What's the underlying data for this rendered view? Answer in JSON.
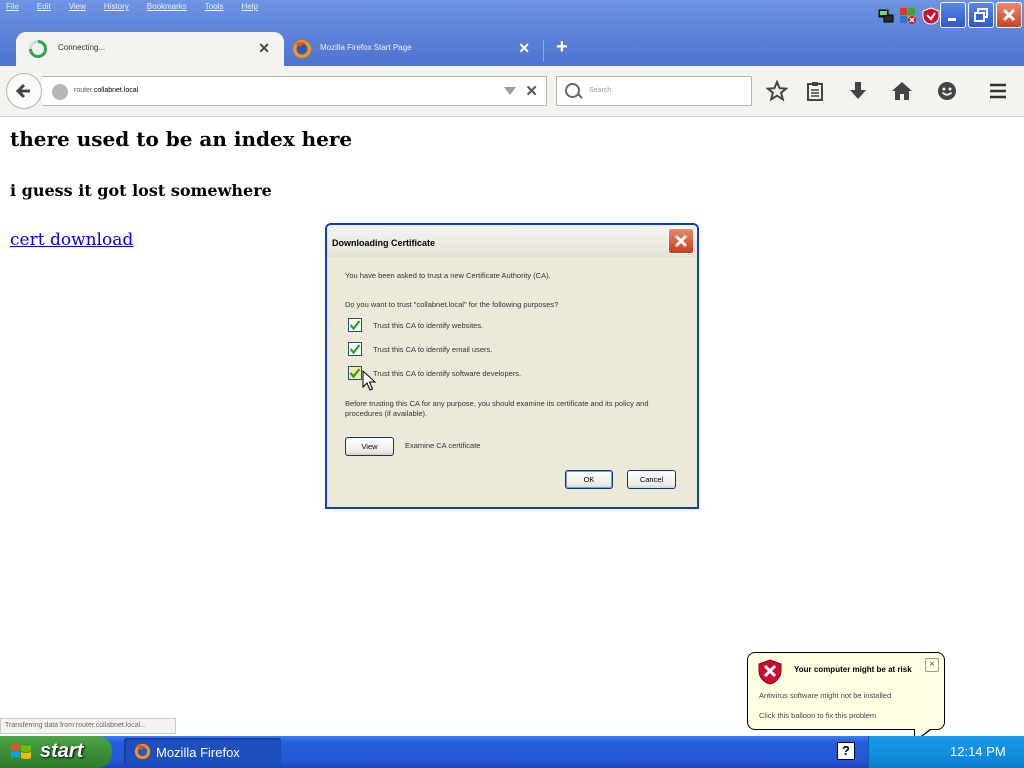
{
  "menu": [
    "File",
    "Edit",
    "View",
    "History",
    "Bookmarks",
    "Tools",
    "Help"
  ],
  "tabs": [
    {
      "label": "Connecting...",
      "close": "✕"
    },
    {
      "label": "Mozilla Firefox Start Page",
      "close": "✕"
    }
  ],
  "new_tab": "+",
  "url": {
    "prefix": "router.",
    "domain": "collabnet.local",
    "stop": "✕"
  },
  "search": {
    "placeholder": "Search"
  },
  "toolbar_icons": [
    "star-icon",
    "reading-list-icon",
    "download-icon",
    "home-icon",
    "hello-icon",
    "hamburger-menu-icon"
  ],
  "page": {
    "heading": "there used to be an index here",
    "subheading": "i guess it got lost somewhere",
    "link": "cert download"
  },
  "dialog": {
    "title": "Downloading Certificate",
    "intro": "You have been asked to trust a new Certificate Authority (CA).",
    "question": "Do you want to trust \"collabnet.local\" for the following purposes?",
    "options": [
      {
        "label": "Trust this CA to identify websites.",
        "checked": true
      },
      {
        "label": "Trust this CA to identify email users.",
        "checked": true
      },
      {
        "label": "Trust this CA to identify software developers.",
        "checked": true
      }
    ],
    "advice": "Before trusting this CA for any purpose, you should examine its certificate and its policy and procedures (if available).",
    "view_button": "View",
    "view_caption": "Examine CA certificate",
    "ok_button": "OK",
    "cancel_button": "Cancel"
  },
  "status": "Transferring data from router.collabnet.local...",
  "balloon": {
    "title": "Your computer might be at risk",
    "line1": "Antivirus software might not be installed",
    "line2": "Click this balloon to fix this problem",
    "close": "×"
  },
  "taskbar": {
    "start": "start",
    "task": "Mozilla Firefox",
    "help": "?",
    "clock": "12:14 PM"
  },
  "colors": {
    "titlebar": "#5a7fd6",
    "taskbar": "#245edb",
    "link": "#0000ee",
    "dialog_border": "#0a3fc4",
    "checkmark": "#21a121"
  }
}
